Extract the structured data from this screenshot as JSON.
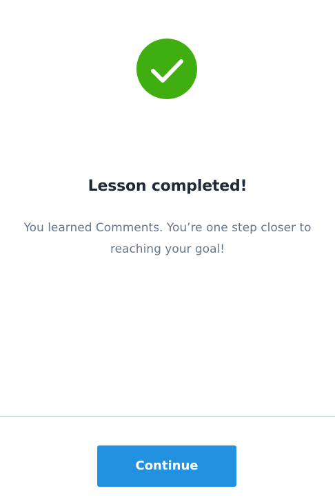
{
  "icon": {
    "name": "checkmark-icon",
    "color": "#40ad10"
  },
  "lesson": {
    "title": "Lesson completed!",
    "message": "You learned Comments. You’re one step closer to reaching your goal!"
  },
  "footer": {
    "continue_label": "Continue",
    "button_color": "#2191e0"
  }
}
